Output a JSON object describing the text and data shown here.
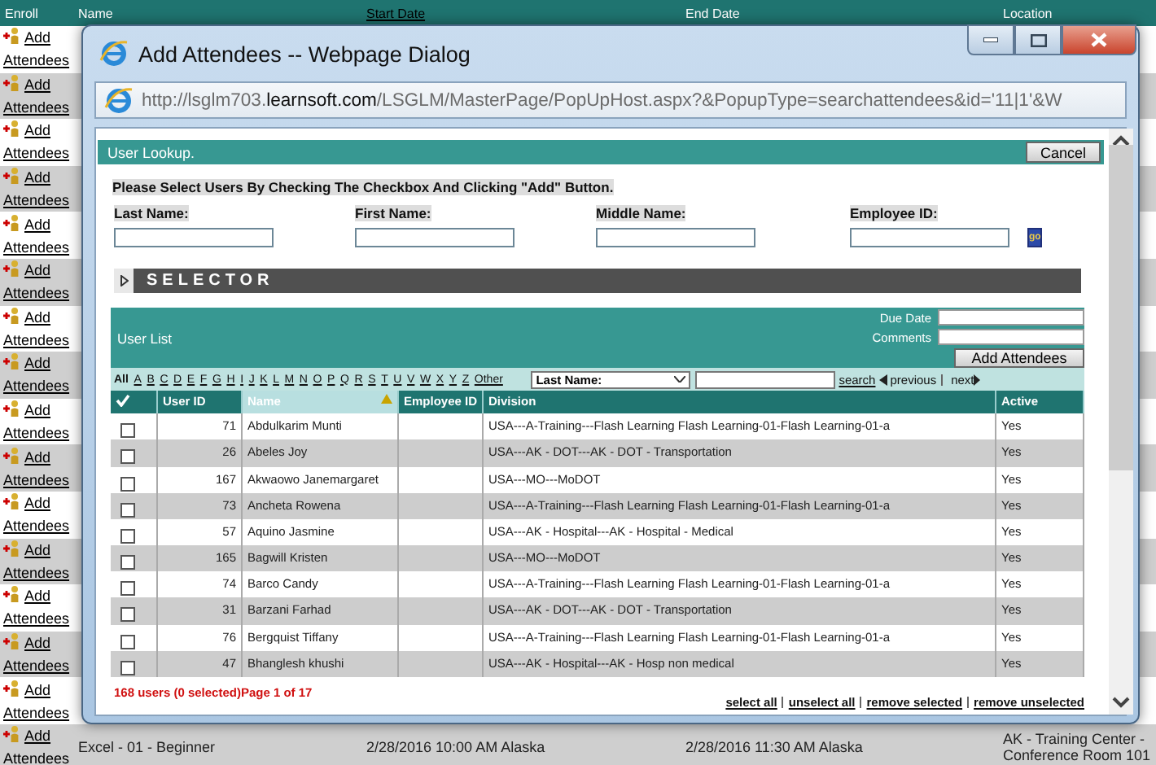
{
  "page": {
    "columns": [
      {
        "label": "Enroll",
        "link": false
      },
      {
        "label": "Name",
        "link": false
      },
      {
        "label": "Start Date",
        "link": true
      },
      {
        "label": "End Date",
        "link": false
      },
      {
        "label": "Location",
        "link": false
      }
    ],
    "rows": [
      {
        "link": "Add Attendees"
      },
      {
        "link": "Add Attendees"
      },
      {
        "link": "Add Attendees"
      },
      {
        "link": "Add Attendees"
      },
      {
        "link": "Add Attendees"
      },
      {
        "link": "Add Attendees"
      },
      {
        "link": "Add Attendees"
      },
      {
        "link": "Add Attendees"
      },
      {
        "link": "Add Attendees"
      },
      {
        "link": "Add Attendees"
      },
      {
        "link": "Add Attendees"
      },
      {
        "link": "Add Attendees"
      },
      {
        "link": "Add Attendees"
      },
      {
        "link": "Add Attendees"
      },
      {
        "link": "Add Attendees"
      },
      {
        "link": "Add Attendees",
        "name": "Excel - 01 - Beginner",
        "start": "2/28/2016 10:00 AM Alaska",
        "end": "2/28/2016 11:30 AM Alaska",
        "location": "AK - Training Center - Conference Room 101"
      }
    ]
  },
  "dialog": {
    "title": "Add Attendees -- Webpage Dialog",
    "url": {
      "prefix": "http://lsglm703.",
      "domain": "learnsoft.com",
      "path": "/LSGLM/MasterPage/PopUpHost.aspx?&PopupType=searchattendees&id='11|1'&W"
    },
    "header": "User Lookup.",
    "cancel": "Cancel",
    "instruction": "Please Select Users By Checking The Checkbox And Clicking \"Add\" Button.",
    "search_fields": [
      "Last Name:",
      "First Name:",
      "Middle Name:",
      "Employee ID:"
    ],
    "go": "go",
    "selector": {
      "label": "SELECTOR",
      "expanded": false
    },
    "user_list": {
      "title": "User List",
      "due_date": "Due Date",
      "comments": "Comments",
      "add_button": "Add Attendees"
    },
    "letters": [
      {
        "label": "All",
        "selected": true
      },
      {
        "label": "A",
        "selected": false
      },
      {
        "label": "B",
        "selected": false
      },
      {
        "label": "C",
        "selected": false
      },
      {
        "label": "D",
        "selected": false
      },
      {
        "label": "E",
        "selected": false
      },
      {
        "label": "F",
        "selected": false
      },
      {
        "label": "G",
        "selected": false
      },
      {
        "label": "H",
        "selected": false
      },
      {
        "label": "I",
        "selected": false
      },
      {
        "label": "J",
        "selected": false
      },
      {
        "label": "K",
        "selected": false
      },
      {
        "label": "L",
        "selected": false
      },
      {
        "label": "M",
        "selected": false
      },
      {
        "label": "N",
        "selected": false
      },
      {
        "label": "O",
        "selected": false
      },
      {
        "label": "P",
        "selected": false
      },
      {
        "label": "Q",
        "selected": false
      },
      {
        "label": "R",
        "selected": false
      },
      {
        "label": "S",
        "selected": false
      },
      {
        "label": "T",
        "selected": false
      },
      {
        "label": "U",
        "selected": false
      },
      {
        "label": "V",
        "selected": false
      },
      {
        "label": "W",
        "selected": false
      },
      {
        "label": "X",
        "selected": false
      },
      {
        "label": "Y",
        "selected": false
      },
      {
        "label": "Z",
        "selected": false
      },
      {
        "label": "Other",
        "selected": false
      }
    ],
    "search_by": "Last Name:",
    "search": "search",
    "previous": "previous",
    "next": "next",
    "table": {
      "columns": [
        {
          "label": "User ID",
          "sorted": false
        },
        {
          "label": "Name",
          "sorted": true
        },
        {
          "label": "Employee ID",
          "sorted": false
        },
        {
          "label": "Division",
          "sorted": false
        },
        {
          "label": "Active",
          "sorted": false
        }
      ],
      "rows": [
        {
          "checked": false,
          "id": "71",
          "name": "Abdulkarim Munti",
          "division": "USA---A-Training---Flash Learning Flash Learning-01-Flash Learning-01-a",
          "active": "Yes"
        },
        {
          "checked": false,
          "id": "26",
          "name": "Abeles Joy",
          "division": "USA---AK - DOT---AK - DOT - Transportation",
          "active": "Yes"
        },
        {
          "checked": false,
          "id": "167",
          "name": "Akwaowo Janemargaret",
          "division": "USA---MO---MoDOT",
          "active": "Yes"
        },
        {
          "checked": false,
          "id": "73",
          "name": "Ancheta Rowena",
          "division": "USA---A-Training---Flash Learning Flash Learning-01-Flash Learning-01-a",
          "active": "Yes"
        },
        {
          "checked": false,
          "id": "57",
          "name": "Aquino Jasmine",
          "division": "USA---AK - Hospital---AK - Hospital - Medical",
          "active": "Yes"
        },
        {
          "checked": false,
          "id": "165",
          "name": "Bagwill Kristen",
          "division": "USA---MO---MoDOT",
          "active": "Yes"
        },
        {
          "checked": false,
          "id": "74",
          "name": "Barco Candy",
          "division": "USA---A-Training---Flash Learning Flash Learning-01-Flash Learning-01-a",
          "active": "Yes"
        },
        {
          "checked": false,
          "id": "31",
          "name": "Barzani Farhad",
          "division": "USA---AK - DOT---AK - DOT - Transportation",
          "active": "Yes"
        },
        {
          "checked": false,
          "id": "76",
          "name": "Bergquist Tiffany",
          "division": "USA---A-Training---Flash Learning Flash Learning-01-Flash Learning-01-a",
          "active": "Yes"
        },
        {
          "checked": false,
          "id": "47",
          "name": "Bhanglesh khushi",
          "division": "USA---AK - Hospital---AK - Hosp non medical",
          "active": "Yes"
        }
      ]
    },
    "status": "168 users (0 selected)Page 1 of 17",
    "actions": [
      "select all",
      "unselect all",
      "remove selected",
      "remove unselected"
    ]
  }
}
